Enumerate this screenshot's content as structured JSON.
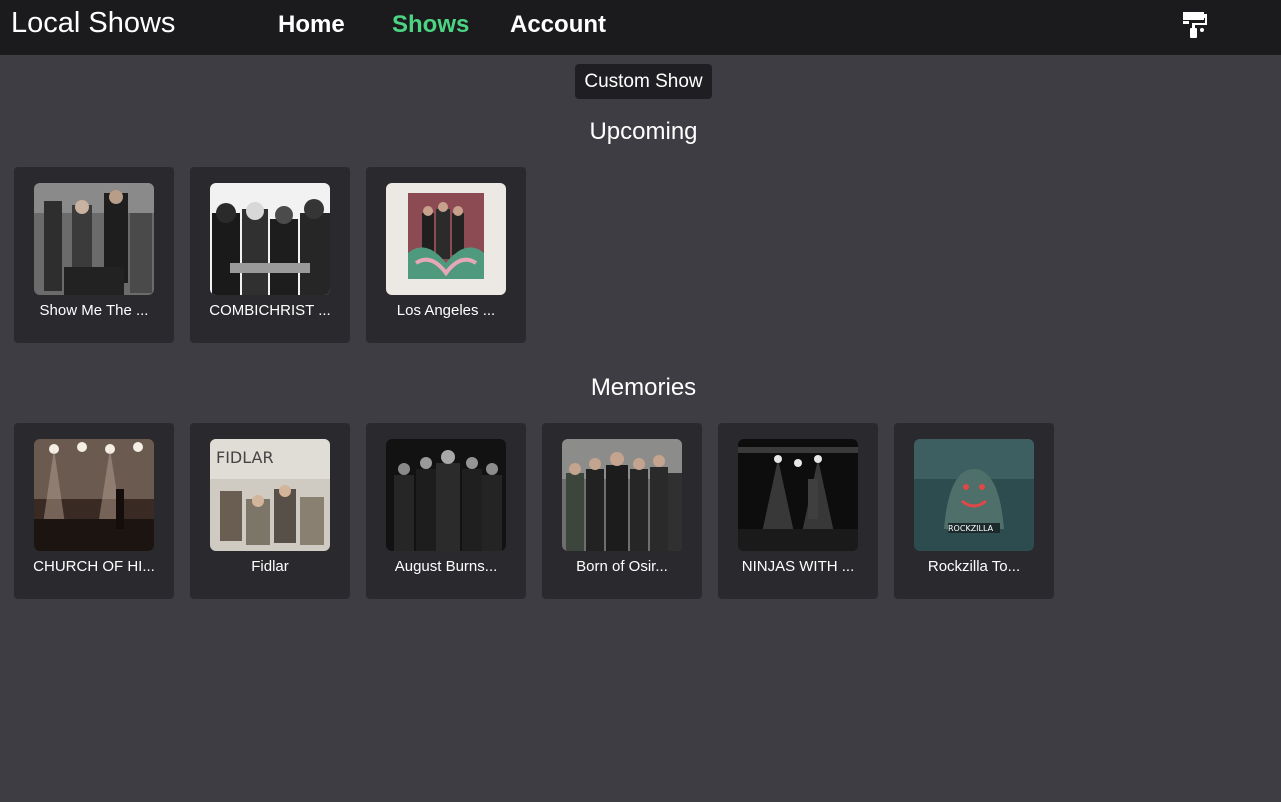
{
  "app": {
    "title": "Local Shows"
  },
  "nav": {
    "items": [
      {
        "label": "Home",
        "active": false
      },
      {
        "label": "Shows",
        "active": true
      },
      {
        "label": "Account",
        "active": false
      }
    ],
    "theme_icon": "paint-roller-icon"
  },
  "actions": {
    "custom_show_label": "Custom Show"
  },
  "sections": {
    "upcoming": {
      "title": "Upcoming",
      "shows": [
        {
          "label": "Show Me The ..."
        },
        {
          "label": "COMBICHRIST ..."
        },
        {
          "label": "Los Angeles ..."
        }
      ]
    },
    "memories": {
      "title": "Memories",
      "shows": [
        {
          "label": "CHURCH OF HI..."
        },
        {
          "label": "Fidlar"
        },
        {
          "label": "August Burns..."
        },
        {
          "label": "Born of Osir..."
        },
        {
          "label": "NINJAS WITH ..."
        },
        {
          "label": "Rockzilla To..."
        }
      ]
    }
  },
  "colors": {
    "background": "#3d3d43",
    "topbar": "#1b1b1e",
    "card": "#2a2a2e",
    "active_nav": "#4cd483",
    "text": "#ffffff"
  }
}
